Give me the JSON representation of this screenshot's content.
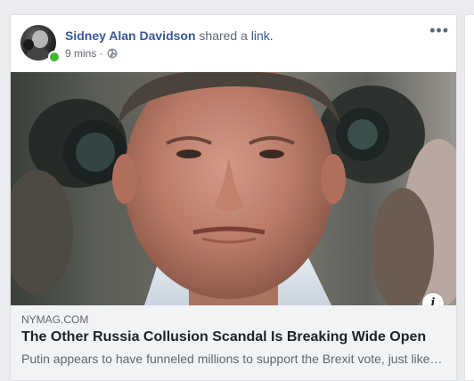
{
  "post": {
    "author": "Sidney Alan Davidson",
    "action": "shared a",
    "object": "link.",
    "time": "9 mins",
    "separator": "·",
    "privacy_icon": "globe-icon",
    "more_icon": "more-options-icon",
    "more_label": "•••"
  },
  "link_preview": {
    "domain": "NYMAG.COM",
    "title": "The Other Russia Collusion Scandal Is Breaking Wide Open",
    "description": "Putin appears to have funneled millions to support the Brexit vote, just like…",
    "info_label": "i"
  },
  "colors": {
    "author_link": "#385898",
    "online": "#42b72a",
    "background": "#e9ebee"
  }
}
